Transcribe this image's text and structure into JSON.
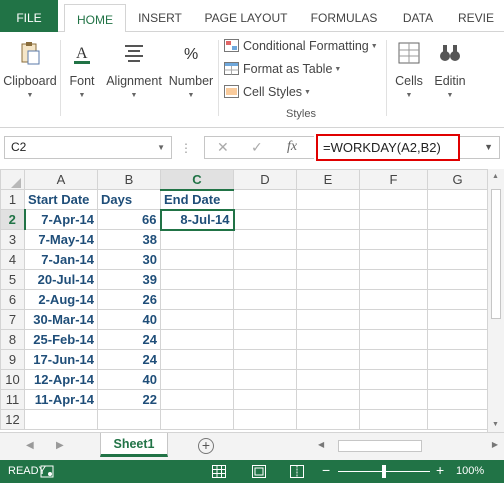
{
  "colors": {
    "accent": "#217346",
    "highlight": "#e00000",
    "cell_text": "#1f4e79"
  },
  "tabs": {
    "file": "FILE",
    "home": "HOME",
    "insert": "INSERT",
    "page_layout": "PAGE LAYOUT",
    "formulas": "FORMULAS",
    "data": "DATA",
    "review": "REVIE"
  },
  "ribbon": {
    "clipboard": "Clipboard",
    "font": "Font",
    "alignment": "Alignment",
    "number": "Number",
    "conditional_formatting": "Conditional Formatting",
    "format_as_table": "Format as Table",
    "cell_styles": "Cell Styles",
    "styles_group": "Styles",
    "cells": "Cells",
    "editing": "Editin"
  },
  "formula_bar": {
    "name_box": "C2",
    "formula": "=WORKDAY(A2,B2)",
    "fx": "fx"
  },
  "grid": {
    "columns": [
      "A",
      "B",
      "C",
      "D",
      "E",
      "F",
      "G"
    ],
    "rows": [
      {
        "n": "1",
        "a": "Start Date",
        "b": "Days",
        "c": "End Date"
      },
      {
        "n": "2",
        "a": "7-Apr-14",
        "b": "66",
        "c": "8-Jul-14"
      },
      {
        "n": "3",
        "a": "7-May-14",
        "b": "38",
        "c": ""
      },
      {
        "n": "4",
        "a": "7-Jan-14",
        "b": "30",
        "c": ""
      },
      {
        "n": "5",
        "a": "20-Jul-14",
        "b": "39",
        "c": ""
      },
      {
        "n": "6",
        "a": "2-Aug-14",
        "b": "26",
        "c": ""
      },
      {
        "n": "7",
        "a": "30-Mar-14",
        "b": "40",
        "c": ""
      },
      {
        "n": "8",
        "a": "25-Feb-14",
        "b": "24",
        "c": ""
      },
      {
        "n": "9",
        "a": "17-Jun-14",
        "b": "24",
        "c": ""
      },
      {
        "n": "10",
        "a": "12-Apr-14",
        "b": "40",
        "c": ""
      },
      {
        "n": "11",
        "a": "11-Apr-14",
        "b": "22",
        "c": ""
      },
      {
        "n": "12",
        "a": "",
        "b": "",
        "c": ""
      }
    ]
  },
  "sheet_tabs": {
    "active": "Sheet1",
    "add_icon": "plus-circle-icon"
  },
  "status": {
    "text": "READY",
    "zoom": "100%",
    "zoom_minus": "−",
    "zoom_plus": "+"
  }
}
